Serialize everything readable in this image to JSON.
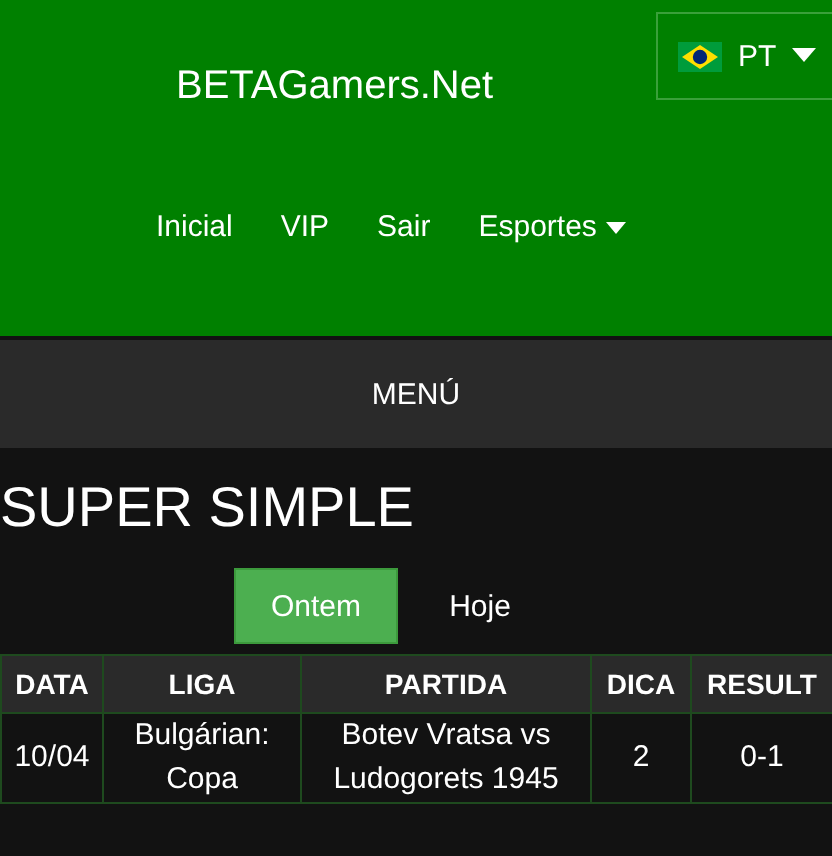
{
  "header": {
    "logo": "BETAGamers.Net",
    "language": {
      "code": "PT"
    },
    "nav": [
      {
        "label": "Inicial",
        "dropdown": false
      },
      {
        "label": "VIP",
        "dropdown": false
      },
      {
        "label": "Sair",
        "dropdown": false
      },
      {
        "label": "Esportes",
        "dropdown": true
      }
    ]
  },
  "menu_bar": {
    "label": "MENÚ"
  },
  "title": "SUPER SIMPLE",
  "tabs": [
    {
      "label": "Ontem",
      "selected": true
    },
    {
      "label": "Hoje",
      "selected": false
    }
  ],
  "table": {
    "columns": [
      "DATA",
      "LIGA",
      "PARTIDA",
      "DICA",
      "RESULT"
    ],
    "rows": [
      [
        "10/04",
        "Bulgárian: Copa",
        "Botev Vratsa vs Ludogorets 1945",
        "2",
        "0-1"
      ]
    ]
  }
}
